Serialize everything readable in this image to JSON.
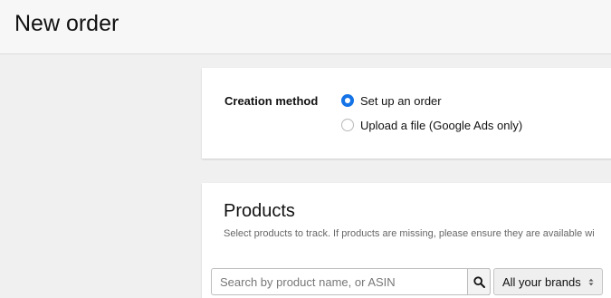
{
  "header": {
    "title": "New order"
  },
  "creation": {
    "label": "Creation method",
    "options": [
      {
        "label": "Set up an order",
        "checked": true
      },
      {
        "label": "Upload a file (Google Ads only)",
        "checked": false
      }
    ]
  },
  "products": {
    "title": "Products",
    "description": "Select products to track. If products are missing, please ensure they are available wi",
    "search": {
      "placeholder": "Search by product name, or ASIN",
      "value": ""
    },
    "brands_select": {
      "value": "All your brands"
    }
  },
  "colors": {
    "accent": "#1473e6",
    "background": "#f0f0f0",
    "card": "#ffffff"
  },
  "icons": {
    "search": "search-icon",
    "select": "chevron-updown-icon"
  }
}
